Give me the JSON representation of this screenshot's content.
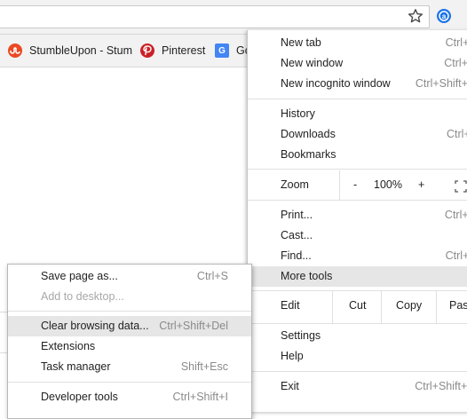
{
  "bookmarks": [
    {
      "label": "StumbleUpon - Stum",
      "icon": "stumbleupon-icon",
      "color": "#eb4924"
    },
    {
      "label": "Pinterest",
      "icon": "pinterest-icon",
      "color": "#cb2027"
    },
    {
      "label": "Go",
      "icon": "google-translate-icon",
      "color": "#4285f4"
    }
  ],
  "menu": {
    "new_tab": {
      "label": "New tab",
      "shortcut": "Ctrl+T"
    },
    "new_window": {
      "label": "New window",
      "shortcut": "Ctrl+N"
    },
    "new_incognito": {
      "label": "New incognito window",
      "shortcut": "Ctrl+Shift+N"
    },
    "history": {
      "label": "History"
    },
    "downloads": {
      "label": "Downloads",
      "shortcut": "Ctrl+J"
    },
    "bookmarks": {
      "label": "Bookmarks"
    },
    "zoom": {
      "label": "Zoom",
      "minus": "-",
      "value": "100%",
      "plus": "+"
    },
    "print": {
      "label": "Print...",
      "shortcut": "Ctrl+P"
    },
    "cast": {
      "label": "Cast..."
    },
    "find": {
      "label": "Find...",
      "shortcut": "Ctrl+F"
    },
    "more_tools": {
      "label": "More tools"
    },
    "edit": {
      "label": "Edit",
      "cut": "Cut",
      "copy": "Copy",
      "paste": "Past"
    },
    "settings": {
      "label": "Settings"
    },
    "help": {
      "label": "Help"
    },
    "exit": {
      "label": "Exit",
      "shortcut": "Ctrl+Shift+Q"
    }
  },
  "submenu": {
    "save_page": {
      "label": "Save page as...",
      "shortcut": "Ctrl+S"
    },
    "add_to_desktop": {
      "label": "Add to desktop..."
    },
    "clear_browsing": {
      "label": "Clear browsing data...",
      "shortcut": "Ctrl+Shift+Del"
    },
    "extensions": {
      "label": "Extensions"
    },
    "task_manager": {
      "label": "Task manager",
      "shortcut": "Shift+Esc"
    },
    "developer_tools": {
      "label": "Developer tools",
      "shortcut": "Ctrl+Shift+I"
    }
  },
  "extension_badge": "a",
  "colors": {
    "highlight": "#e6e6e6",
    "extension": "#1a73e8"
  }
}
